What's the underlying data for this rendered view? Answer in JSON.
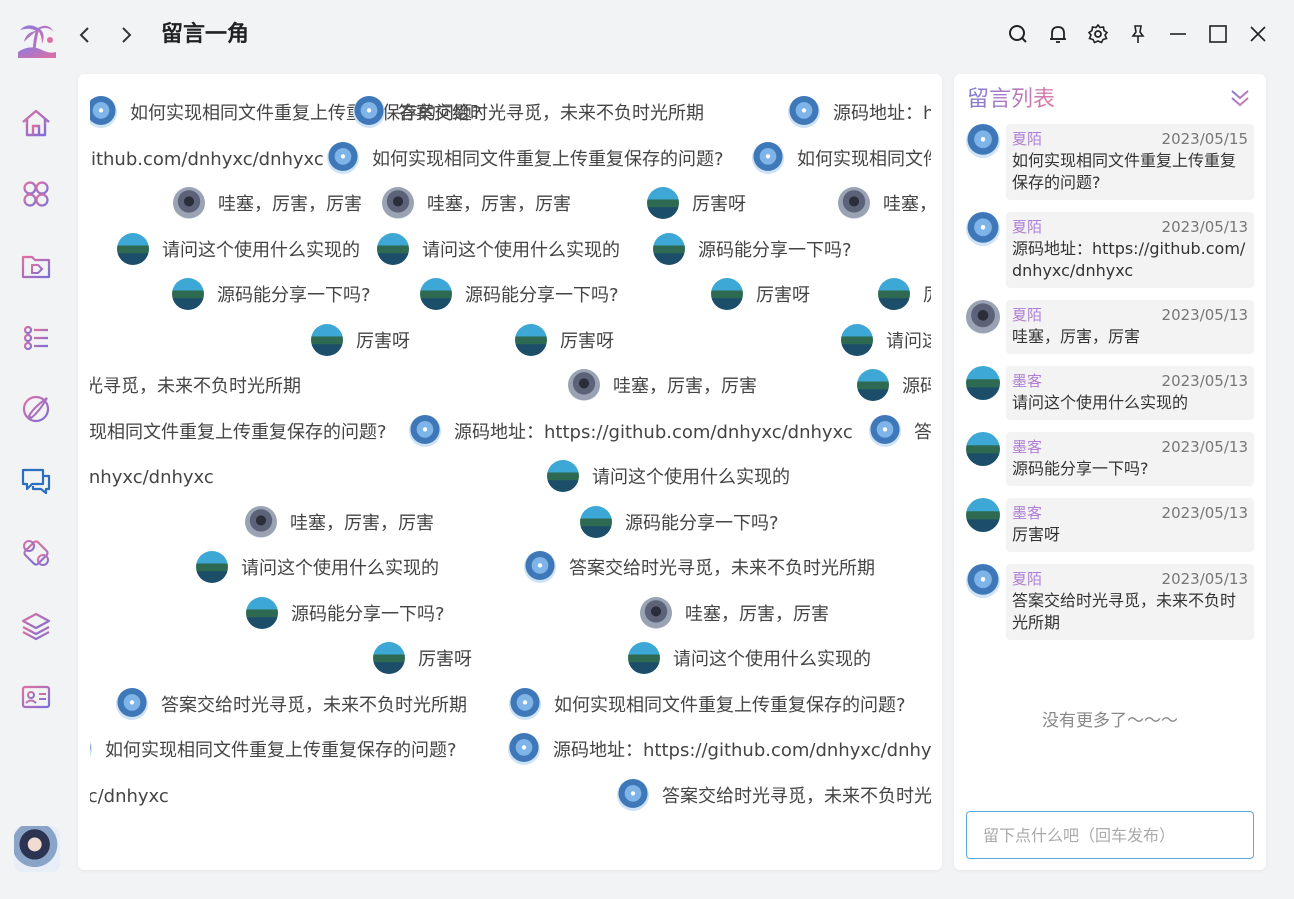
{
  "window": {
    "title": "留言一角"
  },
  "topbar": {
    "icons": [
      "search-icon",
      "bell-icon",
      "gear-icon",
      "pin-icon",
      "minimize-icon",
      "maximize-icon",
      "close-icon"
    ]
  },
  "sidebar": {
    "items": [
      "home-icon",
      "apps-icon",
      "folder-tag-icon",
      "list-settings-icon",
      "brush-icon",
      "chat-icon",
      "puzzle-icon",
      "layers-icon",
      "id-card-icon"
    ]
  },
  "barrage": {
    "items": [
      {
        "avatar": "a",
        "text": "答案交给时光寻觅，未来不负时光所期"
      },
      {
        "avatar": "a",
        "text": "源码地址：https://github.com/dnhyxc/dnhyxc"
      },
      {
        "avatar": "a",
        "text": "如何实现相同文件重复上传重复保存的问题?"
      },
      {
        "avatar": "b",
        "text": "哇塞，厉害，厉害"
      },
      {
        "avatar": "c",
        "text": "厉害呀"
      },
      {
        "avatar": "c",
        "text": "请问这个使用什么实现的"
      },
      {
        "avatar": "c",
        "text": "源码能分享一下吗?"
      }
    ]
  },
  "panel": {
    "title": "留言列表",
    "messages": [
      {
        "avatar": "a",
        "name": "夏陌",
        "date": "2023/05/15",
        "text": "如何实现相同文件重复上传重复保存的问题?"
      },
      {
        "avatar": "a",
        "name": "夏陌",
        "date": "2023/05/13",
        "text": "源码地址：https://github.com/dnhyxc/dnhyxc"
      },
      {
        "avatar": "b",
        "name": "夏陌",
        "date": "2023/05/13",
        "text": "哇塞，厉害，厉害"
      },
      {
        "avatar": "c",
        "name": "墨客",
        "date": "2023/05/13",
        "text": "请问这个使用什么实现的"
      },
      {
        "avatar": "c",
        "name": "墨客",
        "date": "2023/05/13",
        "text": "源码能分享一下吗?"
      },
      {
        "avatar": "c",
        "name": "墨客",
        "date": "2023/05/13",
        "text": "厉害呀"
      },
      {
        "avatar": "a",
        "name": "夏陌",
        "date": "2023/05/13",
        "text": "答案交给时光寻觅，未来不负时光所期"
      }
    ],
    "no_more": "没有更多了～～～",
    "input_placeholder": "留下点什么吧（回车发布）"
  }
}
